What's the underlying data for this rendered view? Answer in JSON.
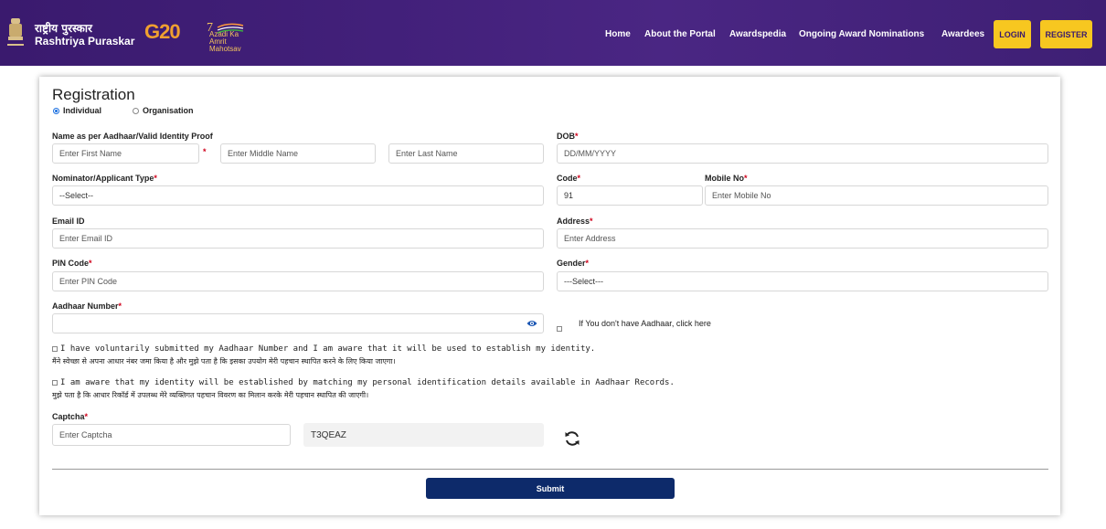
{
  "header": {
    "brand_hindi": "राष्ट्रीय पुरस्कार",
    "brand_english": "Rashtriya Puraskar",
    "g20_logo_text": "G20",
    "azadi_logo_text": "Azadi Ka Amrit Mahotsav",
    "nav": [
      "Home",
      "About the Portal",
      "Awardspedia",
      "Ongoing Award Nominations",
      "Awardees"
    ],
    "login": "LOGIN",
    "register": "REGISTER",
    "colors": {
      "header_bg": "#3e1f74",
      "button_bg": "#f7c720"
    }
  },
  "form": {
    "title": "Registration",
    "radio_options": [
      {
        "label": "Individual",
        "selected": true
      },
      {
        "label": "Organisation",
        "selected": false
      }
    ],
    "name_label": "Name as per Aadhaar/Valid Identity Proof",
    "first_name_placeholder": "Enter First Name",
    "middle_name_placeholder": "Enter Middle Name",
    "last_name_placeholder": "Enter Last Name",
    "dob_label": "DOB",
    "dob_placeholder": "DD/MM/YYYY",
    "nominator_label": "Nominator/Applicant Type",
    "nominator_value": "--Select--",
    "code_label": "Code",
    "code_value": "91",
    "mobile_label": "Mobile No",
    "mobile_placeholder": "Enter Mobile No",
    "email_label": "Email ID",
    "email_placeholder": "Enter Email ID",
    "address_label": "Address",
    "address_placeholder": "Enter Address",
    "pin_label": "PIN Code",
    "pin_placeholder": "Enter PIN Code",
    "gender_label": "Gender",
    "gender_value": "---Select---",
    "aadhaar_label": "Aadhaar Number",
    "no_aadhaar_text": "If You don't have Aadhaar, click here",
    "consent1_en": "I have voluntarily submitted my Aadhaar Number and I am aware that it will be used to establish my identity.",
    "consent1_hi": "मैंने स्वेच्छा से अपना आधार नंबर जमा किया है और मुझे पता है कि इसका उपयोग मेरी पहचान स्थापित करने के लिए किया जाएगा।",
    "consent2_en": "I am aware that my identity will be established by matching my personal identification details available in Aadhaar Records.",
    "consent2_hi": "मुझे पता है कि आधार रिकॉर्ड में उपलब्ध मेरे व्यक्तिगत पहचान विवरण का मिलान करके मेरी पहचान स्थापित की जाएगी।",
    "captcha_label": "Captcha",
    "captcha_placeholder": "Enter Captcha",
    "captcha_code": "T3QEAZ",
    "submit": "Submit",
    "required_mark": "*",
    "colors": {
      "required": "#d0021b",
      "submit_bg": "#0d2a6a",
      "radio_accent": "#1a6fe0"
    },
    "icons": [
      "eye-icon",
      "refresh-icon"
    ]
  }
}
